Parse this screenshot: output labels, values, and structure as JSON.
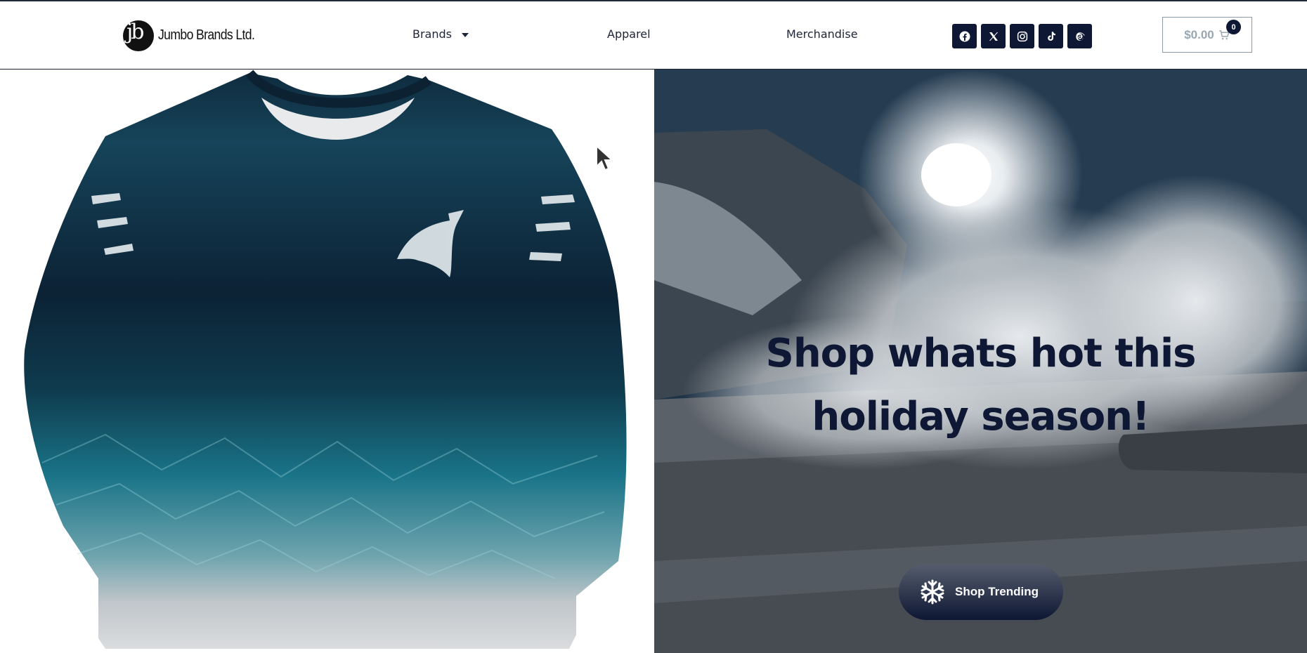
{
  "header": {
    "logo_text": "Jumbo Brands Ltd.",
    "logo_mark": "jb",
    "nav": [
      {
        "label": "Brands"
      },
      {
        "label": "Apparel"
      },
      {
        "label": "Merchandise"
      }
    ],
    "social_icons": [
      "facebook-icon",
      "x-icon",
      "instagram-icon",
      "tiktok-icon",
      "threads-icon"
    ],
    "cart": {
      "total": "$0.00",
      "count": "0"
    }
  },
  "hero": {
    "headline_line1": "Shop whats hot this",
    "headline_line2": "holiday season!",
    "cta_label": "Shop Trending"
  },
  "colors": {
    "brand_navy": "#0e1733",
    "cart_text": "#98a8b2"
  }
}
